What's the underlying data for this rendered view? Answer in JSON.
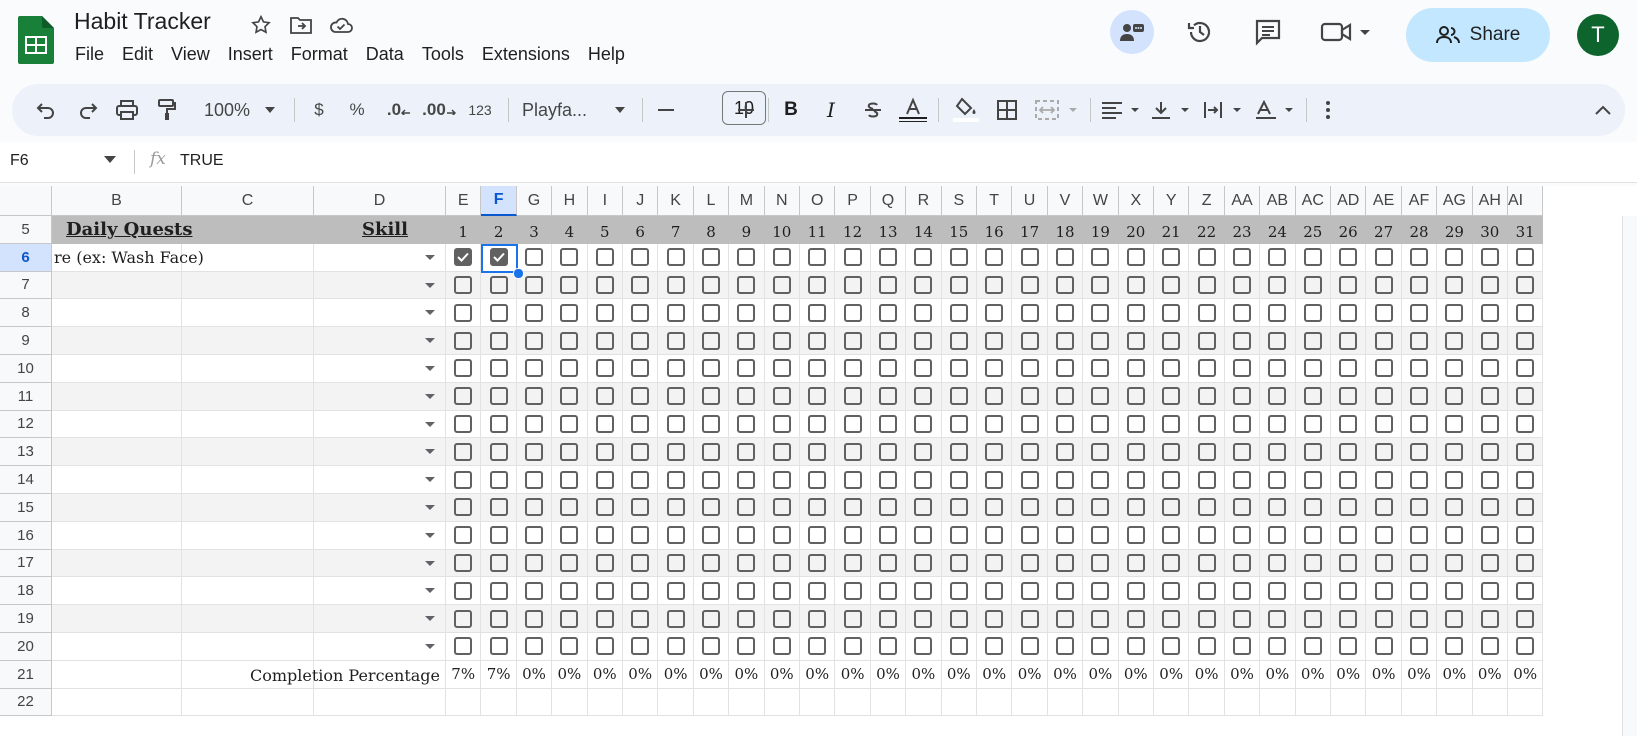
{
  "app": {
    "title": "Habit Tracker",
    "menu": [
      "File",
      "Edit",
      "View",
      "Insert",
      "Format",
      "Data",
      "Tools",
      "Extensions",
      "Help"
    ],
    "share_label": "Share",
    "avatar_letter": "T",
    "brand_color": "#188038",
    "share_color": "#c2e7ff"
  },
  "toolbar": {
    "zoom": "100%",
    "currency": "$",
    "percent": "%",
    "dec_decrease": ".0",
    "dec_increase": ".00",
    "number_format": "123",
    "font": "Playfa...",
    "font_size": "10"
  },
  "formula_bar": {
    "cell_ref": "F6",
    "value": "TRUE"
  },
  "sheet": {
    "columns": [
      "B",
      "C",
      "D",
      "E",
      "F",
      "G",
      "H",
      "I",
      "J",
      "K",
      "L",
      "M",
      "N",
      "O",
      "P",
      "Q",
      "R",
      "S",
      "T",
      "U",
      "V",
      "W",
      "X",
      "Y",
      "Z",
      "AA",
      "AB",
      "AC",
      "AD",
      "AE",
      "AF",
      "AG",
      "AH",
      "AI"
    ],
    "visible_last_column_label": "AI",
    "selected_column": "F",
    "selected_row": "6",
    "rows": [
      "5",
      "6",
      "7",
      "8",
      "9",
      "10",
      "11",
      "12",
      "13",
      "14",
      "15",
      "16",
      "17",
      "18",
      "19",
      "20",
      "21",
      "22"
    ],
    "header_row": {
      "daily_quests": "Daily Quests",
      "skill": "Skill",
      "days": [
        "1",
        "2",
        "3",
        "4",
        "5",
        "6",
        "7",
        "8",
        "9",
        "10",
        "11",
        "12",
        "13",
        "14",
        "15",
        "16",
        "17",
        "18",
        "19",
        "20",
        "21",
        "22",
        "23",
        "24",
        "25",
        "26",
        "27",
        "28",
        "29",
        "30",
        "31"
      ]
    },
    "first_quest": "re (ex: Wash Face)",
    "checked_days_row6": [
      1,
      2
    ],
    "completion_label": "Completion Percentage",
    "completion": [
      "7%",
      "7%",
      "0%",
      "0%",
      "0%",
      "0%",
      "0%",
      "0%",
      "0%",
      "0%",
      "0%",
      "0%",
      "0%",
      "0%",
      "0%",
      "0%",
      "0%",
      "0%",
      "0%",
      "0%",
      "0%",
      "0%",
      "0%",
      "0%",
      "0%",
      "0%",
      "0%",
      "0%",
      "0%",
      "0%",
      "0%"
    ],
    "header_fill": "#bdbdbd",
    "checkbox_color": "#616161",
    "selection_color": "#1a73e8"
  }
}
